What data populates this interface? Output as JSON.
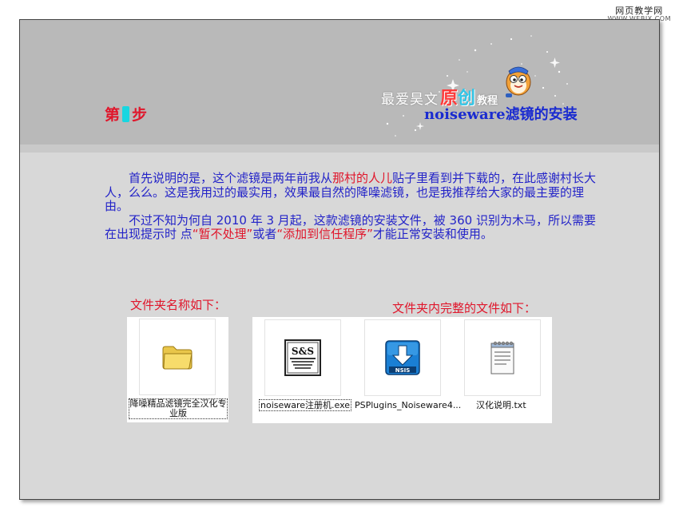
{
  "watermark": {
    "main": "网页教学网",
    "url": "WWW.WEBJX.COM"
  },
  "header": {
    "step_prefix": "第",
    "step_suffix": "步",
    "brand_part1": "最爱昊文",
    "brand_part2": "原",
    "brand_part3": "创",
    "brand_part4": "教程",
    "subtitle": "noiseware滤镜的安装"
  },
  "body": {
    "p1_before": "首先说明的是，这个滤镜是两年前我从",
    "p1_link": "那村的人儿",
    "p1_after": "贴子里看到并下载的，在此感谢村长大人，么么。这是我用过的最实用，效果最自然的降噪滤镜，也是我推荐给大家的最主要的理由。",
    "p2_before": "不过不知为何自 2010 年 3 月起，这款滤镜的安装文件，被 360 识别为木马，所以需要在出现提示时 点",
    "p2_q1": "“暂不处理”",
    "p2_mid": "或者",
    "p2_q2": "“添加到信任程序”",
    "p2_after": "才能正常安装和使用。"
  },
  "sections": {
    "folder_label": "文件夹名称如下：",
    "files_label": "文件夹内完整的文件如下："
  },
  "folder": {
    "name": "降噪精品滤镜完全汉化专业版",
    "icon": "folder-icon"
  },
  "files": [
    {
      "name": "noiseware注册机.exe",
      "icon": "sas-keygen-icon"
    },
    {
      "name": "PSPlugins_Noiseware4...",
      "icon": "nsis-installer-icon"
    },
    {
      "name": "汉化说明.txt",
      "icon": "notepad-text-icon"
    }
  ],
  "colors": {
    "panel_bg": "#d8d8d8",
    "header_bg": "#b9b9b9",
    "body_text": "#2323c8",
    "highlight": "#e0162b",
    "subtitle": "#1a2bd0",
    "step_marker": "#19d6e0"
  }
}
